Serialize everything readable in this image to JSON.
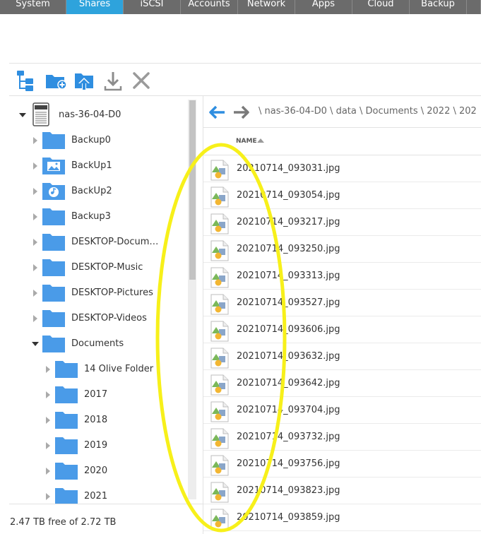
{
  "tabs": [
    {
      "label": "System",
      "active": false
    },
    {
      "label": "Shares",
      "active": true
    },
    {
      "label": "iSCSI",
      "active": false
    },
    {
      "label": "Accounts",
      "active": false
    },
    {
      "label": "Network",
      "active": false
    },
    {
      "label": "Apps",
      "active": false
    },
    {
      "label": "Cloud",
      "active": false
    },
    {
      "label": "Backup",
      "active": false
    },
    {
      "label": "",
      "active": false
    }
  ],
  "toolbar": {
    "icons": [
      "folder-tree-icon",
      "new-folder-icon",
      "upload-icon",
      "download-icon",
      "delete-icon"
    ]
  },
  "tree": {
    "root": {
      "label": "nas-36-04-D0",
      "icon": "nas-device-icon"
    },
    "items": [
      {
        "label": "Backup0",
        "icon": "folder-icon",
        "expanded": false,
        "level": 1
      },
      {
        "label": "BackUp1",
        "icon": "folder-picture-icon",
        "expanded": false,
        "level": 1
      },
      {
        "label": "BackUp2",
        "icon": "folder-music-icon",
        "expanded": false,
        "level": 1
      },
      {
        "label": "Backup3",
        "icon": "folder-icon",
        "expanded": false,
        "level": 1
      },
      {
        "label": "DESKTOP-Docum…",
        "icon": "folder-icon",
        "expanded": false,
        "level": 1
      },
      {
        "label": "DESKTOP-Music",
        "icon": "folder-icon",
        "expanded": false,
        "level": 1
      },
      {
        "label": "DESKTOP-Pictures",
        "icon": "folder-icon",
        "expanded": false,
        "level": 1
      },
      {
        "label": "DESKTOP-Videos",
        "icon": "folder-icon",
        "expanded": false,
        "level": 1
      },
      {
        "label": "Documents",
        "icon": "folder-icon",
        "expanded": true,
        "level": 1
      },
      {
        "label": "14 Olive Folder",
        "icon": "folder-icon",
        "expanded": false,
        "level": 2
      },
      {
        "label": "2017",
        "icon": "folder-icon",
        "expanded": false,
        "level": 2
      },
      {
        "label": "2018",
        "icon": "folder-icon",
        "expanded": false,
        "level": 2
      },
      {
        "label": "2019",
        "icon": "folder-icon",
        "expanded": false,
        "level": 2
      },
      {
        "label": "2020",
        "icon": "folder-icon",
        "expanded": false,
        "level": 2
      },
      {
        "label": "2021",
        "icon": "folder-icon",
        "expanded": false,
        "level": 2
      }
    ]
  },
  "storage": {
    "text": "2.47 TB free of 2.72 TB"
  },
  "path": {
    "text": "\\ nas-36-04-D0 \\ data \\ Documents \\ 2022 \\ 202"
  },
  "filelist": {
    "column_name": "NAME",
    "files": [
      "20210714_093031.jpg",
      "20210714_093054.jpg",
      "20210714_093217.jpg",
      "20210714_093250.jpg",
      "20210714_093313.jpg",
      "20210714_093527.jpg",
      "20210714_093606.jpg",
      "20210714_093632.jpg",
      "20210714_093642.jpg",
      "20210714_093704.jpg",
      "20210714_093732.jpg",
      "20210714_093756.jpg",
      "20210714_093823.jpg",
      "20210714_093859.jpg"
    ]
  },
  "colors": {
    "accent": "#2ea3dc",
    "folder": "#4a9be8",
    "annotation": "#f7f01a"
  }
}
